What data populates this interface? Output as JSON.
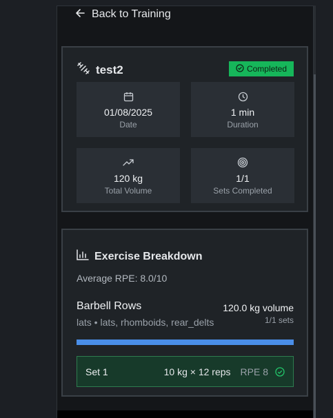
{
  "nav": {
    "back_label": "Back to Training"
  },
  "session": {
    "name": "test2",
    "status": "Completed",
    "stats": [
      {
        "icon": "calendar-icon",
        "value": "01/08/2025",
        "label": "Date"
      },
      {
        "icon": "clock-icon",
        "value": "1 min",
        "label": "Duration"
      },
      {
        "icon": "trending-up-icon",
        "value": "120 kg",
        "label": "Total Volume"
      },
      {
        "icon": "target-icon",
        "value": "1/1",
        "label": "Sets Completed"
      }
    ]
  },
  "breakdown": {
    "title": "Exercise Breakdown",
    "average_rpe": "Average RPE: 8.0/10",
    "exercise": {
      "name": "Barbell Rows",
      "muscles": "lats • lats, rhomboids, rear_delts",
      "volume": "120.0 kg volume",
      "sets": "1/1 sets",
      "progress_fraction": 1.0,
      "set": {
        "label": "Set 1",
        "detail": "10 kg × 12 reps",
        "rpe": "RPE 8"
      }
    }
  },
  "colors": {
    "success": "#16b65a",
    "progress": "#4a8ee8",
    "set_bg": "#173a2a"
  }
}
